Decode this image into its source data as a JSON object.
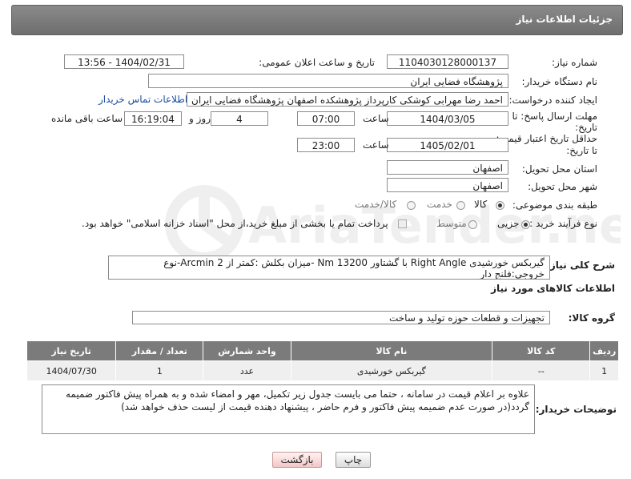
{
  "header": {
    "title": "جزئیات اطلاعات نیاز"
  },
  "fields": {
    "need_number_label": "شماره نیاز:",
    "need_number": "1104030128000137",
    "announce_label": "تاریخ و ساعت اعلان عمومی:",
    "announce_value": "1404/02/31 - 13:56",
    "buyer_org_label": "نام دستگاه خریدار:",
    "buyer_org": "پژوهشگاه فضایی ایران",
    "creator_label": "ایجاد کننده درخواست:",
    "creator": "احمد رضا مهرابی کوشکی کارپرداز پژوهشکده اصفهان پژوهشگاه فضایی ایران",
    "contact_link": "اطلاعات تماس خریدار",
    "deadline_label_1": "مهلت ارسال پاسخ: تا",
    "deadline_label_2": "تاریخ:",
    "deadline_date": "1404/03/05",
    "time_label": "ساعت",
    "deadline_time": "07:00",
    "days_value": "4",
    "days_label": "روز و",
    "remaining_time": "16:19:04",
    "remaining_label": "ساعت باقی مانده",
    "validity_label_1": "حداقل تاریخ اعتبار قیمت:",
    "validity_label_2": "تا تاریخ:",
    "validity_date": "1405/02/01",
    "validity_time_label": "ساعت",
    "validity_time": "23:00",
    "province_label": "استان محل تحویل:",
    "province": "اصفهان",
    "city_label": "شهر محل تحویل:",
    "city": "اصفهان",
    "category_label": "طبقه بندی موضوعی:",
    "category_options": [
      "کالا",
      "خدمت",
      "کالا/خدمت"
    ],
    "process_label": "نوع فرآیند خرید :",
    "process_options": [
      "جزیی",
      "متوسط"
    ],
    "payment_note": "پرداخت تمام یا بخشی از مبلغ خرید،از محل \"اسناد خزانه اسلامی\" خواهد بود."
  },
  "description": {
    "label": "شرح کلی نیاز:",
    "text": "گیربکس خورشیدی Right Angle با گشتاور 13200 Nm -میزان بکلش :کمتر از Arcmin 2-نوع خروجی:فلنج دار"
  },
  "goods": {
    "section_title": "اطلاعات کالاهای مورد نیاز",
    "group_label": "گروه کالا:",
    "group_value": "تجهیزات و قطعات حوزه تولید و ساخت",
    "columns": [
      "ردیف",
      "کد کالا",
      "نام کالا",
      "واحد شمارش",
      "تعداد / مقدار",
      "تاریخ نیاز"
    ],
    "rows": [
      [
        "1",
        "--",
        "گیربکس خورشیدی",
        "عدد",
        "1",
        "1404/07/30"
      ]
    ]
  },
  "buyer_notes": {
    "label": "توضیحات خریدار:",
    "text": "علاوه بر اعلام قیمت در سامانه ، حتما می بایست جدول زیر تکمیل، مهر و امضاء شده و به همراه پیش فاکتور ضمیمه گردد(در صورت عدم ضمیمه پیش فاکتور و فرم حاضر ، پیشنهاد دهنده قیمت از لیست حذف خواهد شد)"
  },
  "buttons": {
    "print": "چاپ",
    "back": "بازگشت"
  },
  "watermark": {
    "text": "AriaTender.neT"
  }
}
